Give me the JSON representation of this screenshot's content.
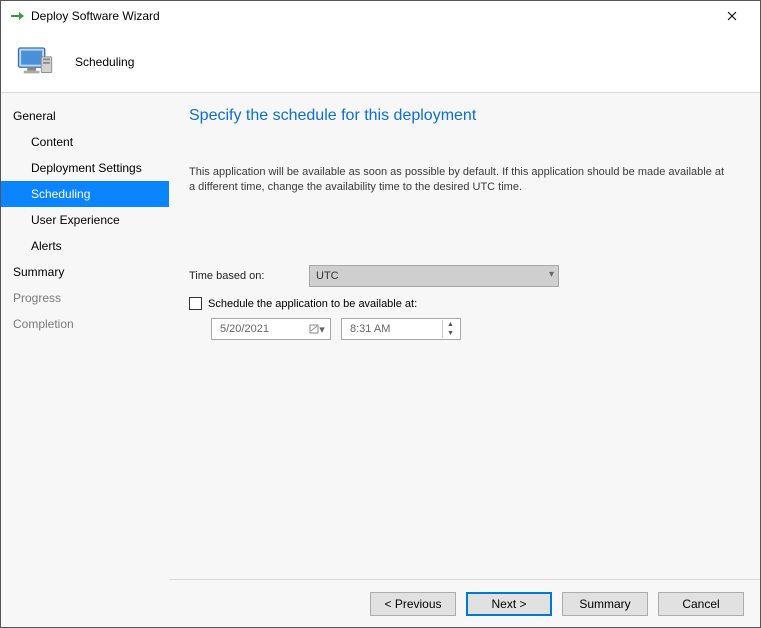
{
  "window": {
    "title": "Deploy Software Wizard"
  },
  "header": {
    "pagename": "Scheduling"
  },
  "sidebar": {
    "items": [
      {
        "label": "General",
        "sub": false,
        "selected": false,
        "dim": false
      },
      {
        "label": "Content",
        "sub": true,
        "selected": false,
        "dim": false
      },
      {
        "label": "Deployment Settings",
        "sub": true,
        "selected": false,
        "dim": false
      },
      {
        "label": "Scheduling",
        "sub": true,
        "selected": true,
        "dim": false
      },
      {
        "label": "User Experience",
        "sub": true,
        "selected": false,
        "dim": false
      },
      {
        "label": "Alerts",
        "sub": true,
        "selected": false,
        "dim": false
      },
      {
        "label": "Summary",
        "sub": false,
        "selected": false,
        "dim": false
      },
      {
        "label": "Progress",
        "sub": false,
        "selected": false,
        "dim": true
      },
      {
        "label": "Completion",
        "sub": false,
        "selected": false,
        "dim": true
      }
    ]
  },
  "content": {
    "heading": "Specify the schedule for this deployment",
    "description": "This application will be available as soon as possible by default. If this application should be made available at a different time, change the availability time to the desired UTC time.",
    "time_based_label": "Time based on:",
    "time_based_value": "UTC",
    "schedule_checkbox_label": "Schedule the application to be available at:",
    "schedule_checked": false,
    "date_value": "5/20/2021",
    "time_value": "8:31 AM"
  },
  "footer": {
    "previous": "< Previous",
    "next": "Next >",
    "summary": "Summary",
    "cancel": "Cancel"
  }
}
